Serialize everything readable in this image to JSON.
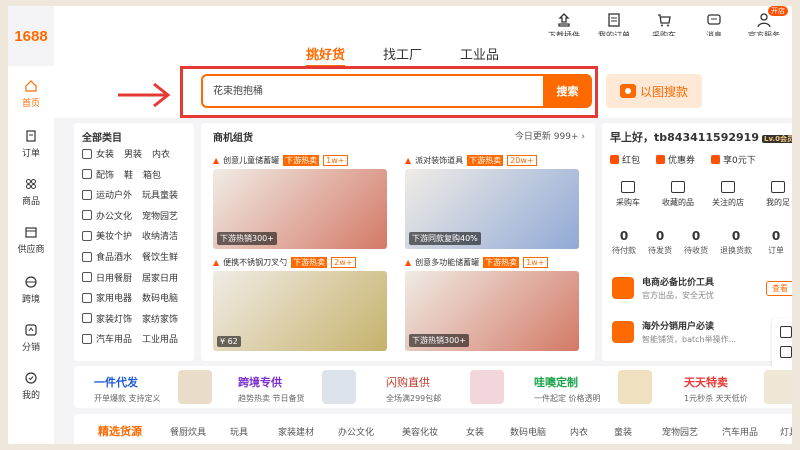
{
  "logo": "1688",
  "top_icons": [
    {
      "icon": "download-plugin-icon",
      "label": "下载插件"
    },
    {
      "icon": "my-orders-icon",
      "label": "我的订单"
    },
    {
      "icon": "cart-icon",
      "label": "采购车"
    },
    {
      "icon": "message-icon",
      "label": "消息"
    },
    {
      "icon": "official-service-icon",
      "label": "官方服务",
      "badge": "开店"
    }
  ],
  "search_tabs": [
    "挑好货",
    "找工厂",
    "工业品"
  ],
  "search": {
    "value": "花束抱抱桶",
    "button": "搜索",
    "image_search": "以图搜款"
  },
  "sidebar": [
    {
      "icon": "home-icon",
      "label": "首页",
      "active": true
    },
    {
      "icon": "order-icon",
      "label": "订单"
    },
    {
      "icon": "product-icon",
      "label": "商品"
    },
    {
      "icon": "supplier-icon",
      "label": "供应商"
    },
    {
      "icon": "cross-border-icon",
      "label": "跨境"
    },
    {
      "icon": "distribution-icon",
      "label": "分销"
    },
    {
      "icon": "my-icon",
      "label": "我的"
    }
  ],
  "categories": {
    "title": "全部类目",
    "rows": [
      [
        "女装",
        "男装",
        "内衣"
      ],
      [
        "配饰",
        "鞋",
        "箱包"
      ],
      [
        "运动户外",
        "玩具童装"
      ],
      [
        "办公文化",
        "宠物园艺"
      ],
      [
        "美妆个护",
        "收纳清洁"
      ],
      [
        "食品酒水",
        "餐饮生鲜"
      ],
      [
        "日用餐厨",
        "居家日用"
      ],
      [
        "家用电器",
        "数码电脑"
      ],
      [
        "家装灯饰",
        "家纺家饰"
      ],
      [
        "汽车用品",
        "工业用品"
      ]
    ]
  },
  "deals": {
    "title": "商机组货",
    "update": "今日更新 999+",
    "items": [
      {
        "title": "创意儿童储蓄罐",
        "tag": "下游热卖",
        "count": "1w+",
        "caption": "下游热销300+",
        "color": "#c84b32"
      },
      {
        "title": "派对装饰道具",
        "tag": "下游热卖",
        "count": "20w+",
        "caption": "下游同款复购40%",
        "color": "#6a8fd0"
      },
      {
        "title": "便携不锈钢刀叉勺",
        "tag": "下游热卖",
        "count": "2w+",
        "caption": "¥ 62",
        "color": "#b59a3a"
      },
      {
        "title": "创意多功能储蓄罐",
        "tag": "下游热卖",
        "count": "1w+",
        "caption": "下游热销300+",
        "color": "#c84b32"
      }
    ]
  },
  "user": {
    "greeting": "早上好，tb843411592919",
    "level": "Lv.0会员",
    "benefits": [
      "红包",
      "优惠券",
      "享0元下"
    ],
    "shortcuts": [
      "采购车",
      "收藏的品",
      "关注的店",
      "我的足"
    ],
    "stats": [
      {
        "n": "0",
        "l": "待付款"
      },
      {
        "n": "0",
        "l": "待发货"
      },
      {
        "n": "0",
        "l": "待收货"
      },
      {
        "n": "0",
        "l": "退换货款"
      },
      {
        "n": "0",
        "l": "订单"
      }
    ],
    "services": [
      {
        "title": "电商必备比价工具",
        "sub": "官方出品，安全无忧",
        "button": "查看"
      },
      {
        "title": "海外分销用户必读",
        "sub": "智能铺货，batch举操作..."
      }
    ]
  },
  "promos": [
    {
      "title": "一件代发",
      "sub": "开单爆款 支持定义",
      "color": "#1e5bd6"
    },
    {
      "title": "跨境专供",
      "sub": "趋势热卖 节日备货",
      "color": "#7b2fd0"
    },
    {
      "title": "闪购直供",
      "sub": "全场满299包邮",
      "color": "#c0392b"
    },
    {
      "title": "哇噢定制",
      "sub": "一件起定 价格透明",
      "color": "#1aa34a"
    },
    {
      "title": "天天特卖",
      "sub": "1元秒杀 天天低价",
      "color": "#e53935"
    }
  ],
  "bottom_categories": [
    "精选货源",
    "餐厨炊具",
    "玩具",
    "家装建材",
    "办公文化",
    "美容化妆",
    "女装",
    "数码电脑",
    "内衣",
    "童装",
    "宠物园艺",
    "汽车用品",
    "灯具"
  ]
}
